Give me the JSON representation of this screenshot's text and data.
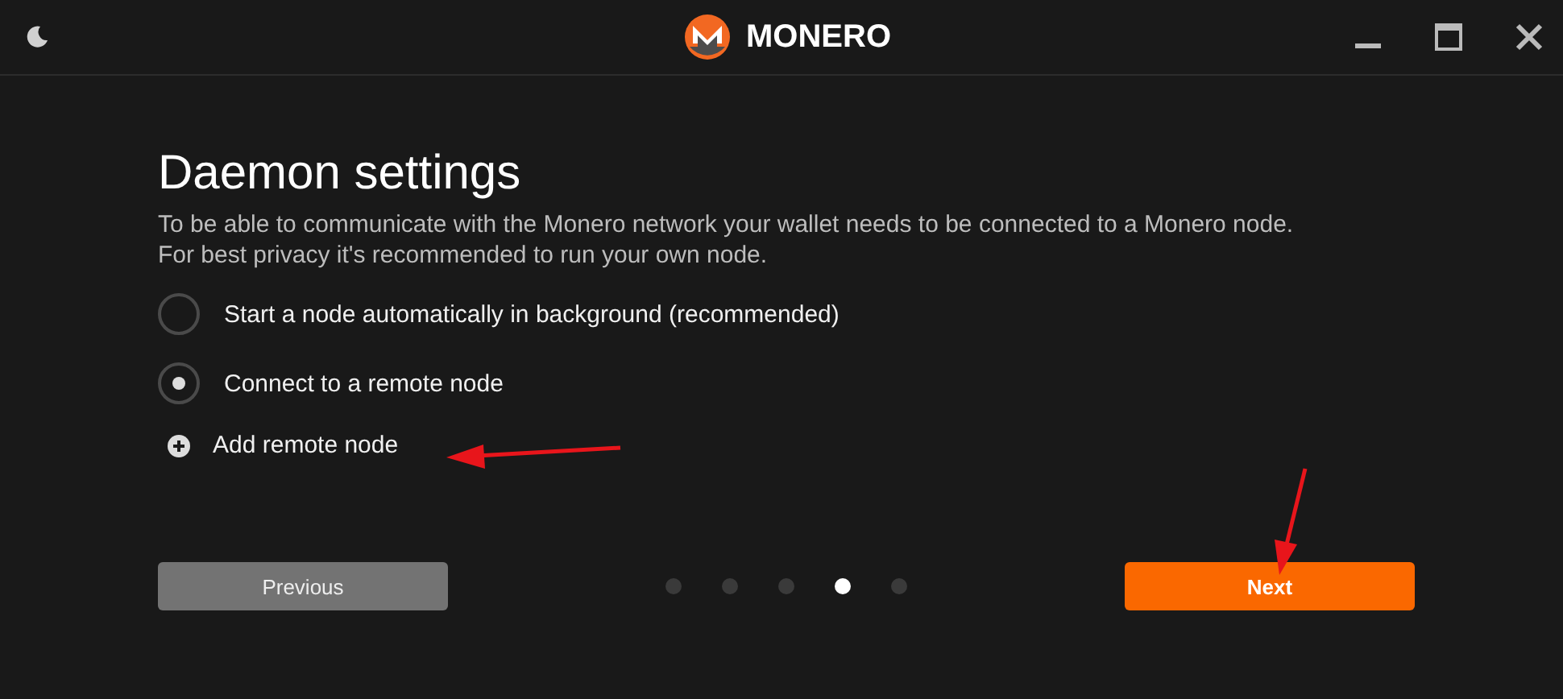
{
  "window": {
    "title": "MONERO"
  },
  "heading": "Daemon settings",
  "description": [
    "To be able to communicate with the Monero network your wallet needs to be connected to a Monero node.",
    "For best privacy it's recommended to run your own node."
  ],
  "options": [
    {
      "label": "Start a node automatically in background (recommended)",
      "selected": false
    },
    {
      "label": "Connect to a remote node",
      "selected": true
    }
  ],
  "add_node": {
    "label": "Add remote node"
  },
  "previous_button": "Previous",
  "steps": [
    {
      "selected": false
    },
    {
      "selected": false
    },
    {
      "selected": false
    },
    {
      "selected": true
    },
    {
      "selected": false
    }
  ],
  "next_button": "Next"
}
